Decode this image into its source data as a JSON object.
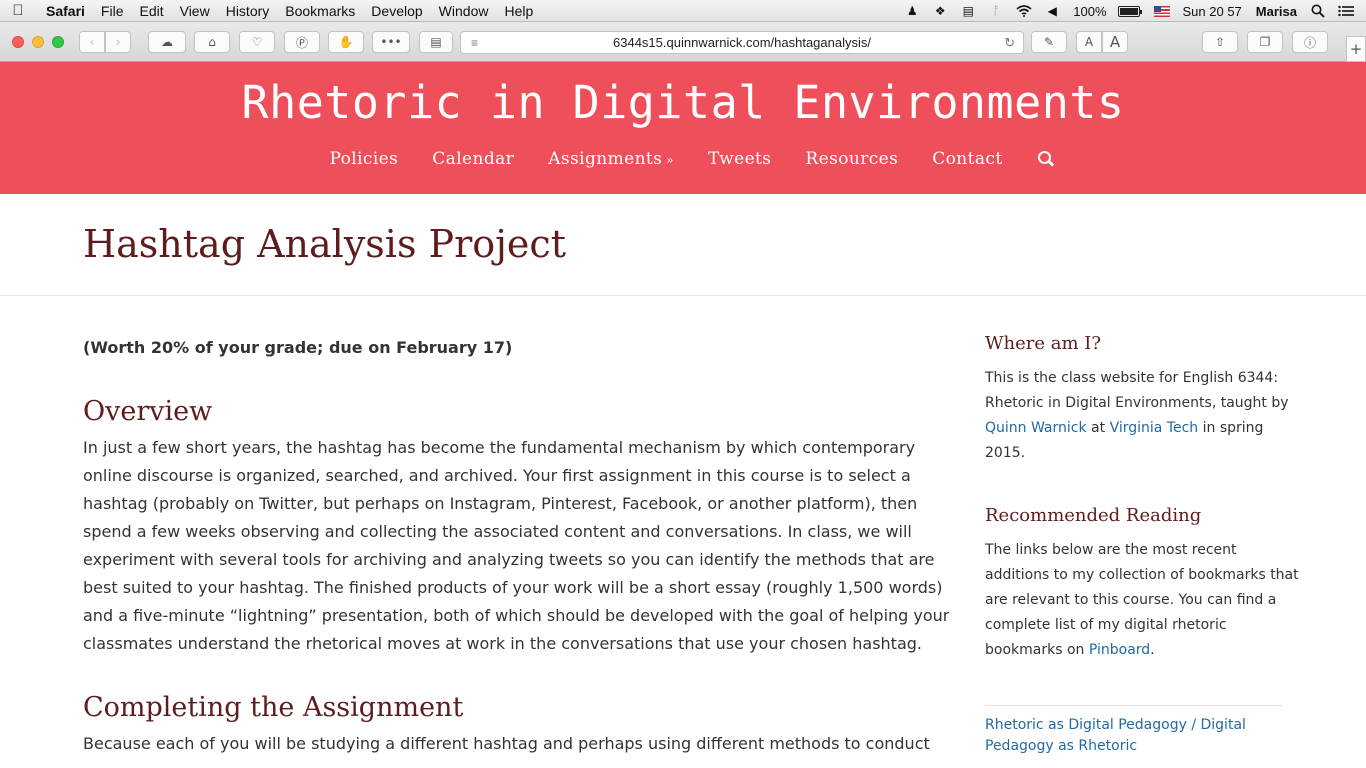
{
  "menubar": {
    "apple": "",
    "items": [
      "Safari",
      "File",
      "Edit",
      "View",
      "History",
      "Bookmarks",
      "Develop",
      "Window",
      "Help"
    ],
    "battery": "100%",
    "clock": "Sun 20 57",
    "user": "Marisa"
  },
  "browser": {
    "url": "6344s15.quinnwarnick.com/hashtaganalysis/",
    "font_small": "A",
    "font_large": "A"
  },
  "site": {
    "title": "Rhetoric in Digital Environments",
    "nav": [
      "Policies",
      "Calendar",
      "Assignments",
      "Tweets",
      "Resources",
      "Contact"
    ]
  },
  "page": {
    "title": "Hashtag Analysis Project",
    "worth": "(Worth 20% of your grade; due on February 17)",
    "overview_heading": "Overview",
    "overview_lines": [
      "In just a few short years, the hashtag has become the fundamental mechanism by which contemporary",
      "online discourse is organized, searched, and archived. Your first assignment in this course is to select a",
      "hashtag (probably on Twitter, but perhaps on Instagram, Pinterest, Facebook, or another platform), then",
      "spend a few weeks observing and collecting the associated content and conversations. In class, we will",
      "experiment with several tools for archiving and analyzing tweets so you can identify the methods that are",
      "best suited to your hashtag. The finished products of your work will be a short essay (roughly 1,500 words)",
      "and a five-minute “lightning” presentation, both of which should be developed with the goal of helping your",
      "classmates understand the rhetorical moves at work in the conversations that use your chosen hashtag."
    ],
    "completing_heading": "Completing the Assignment",
    "completing_line": "Because each of you will be studying a different hashtag and perhaps using different methods to conduct"
  },
  "sidebar": {
    "where_heading": "Where am I?",
    "where_line1": "This is the class website for English 6344:",
    "where_line2": "Rhetoric in Digital Environments, taught by",
    "where_link1": "Quinn Warnick",
    "where_at": " at ",
    "where_link2": "Virginia Tech",
    "where_in": " in spring",
    "where_line4": "2015.",
    "rec_heading": "Recommended Reading",
    "rec_lines": [
      "The links below are the most recent",
      "additions to my collection of bookmarks that",
      "are relevant to this course. You can find a",
      "complete list of my digital rhetoric"
    ],
    "rec_last_prefix": "bookmarks on ",
    "rec_last_link": "Pinboard",
    "rec_last_suffix": ".",
    "rec_item_lines": [
      "Rhetoric as Digital Pedagogy / Digital",
      "Pedagogy as Rhetoric"
    ]
  }
}
